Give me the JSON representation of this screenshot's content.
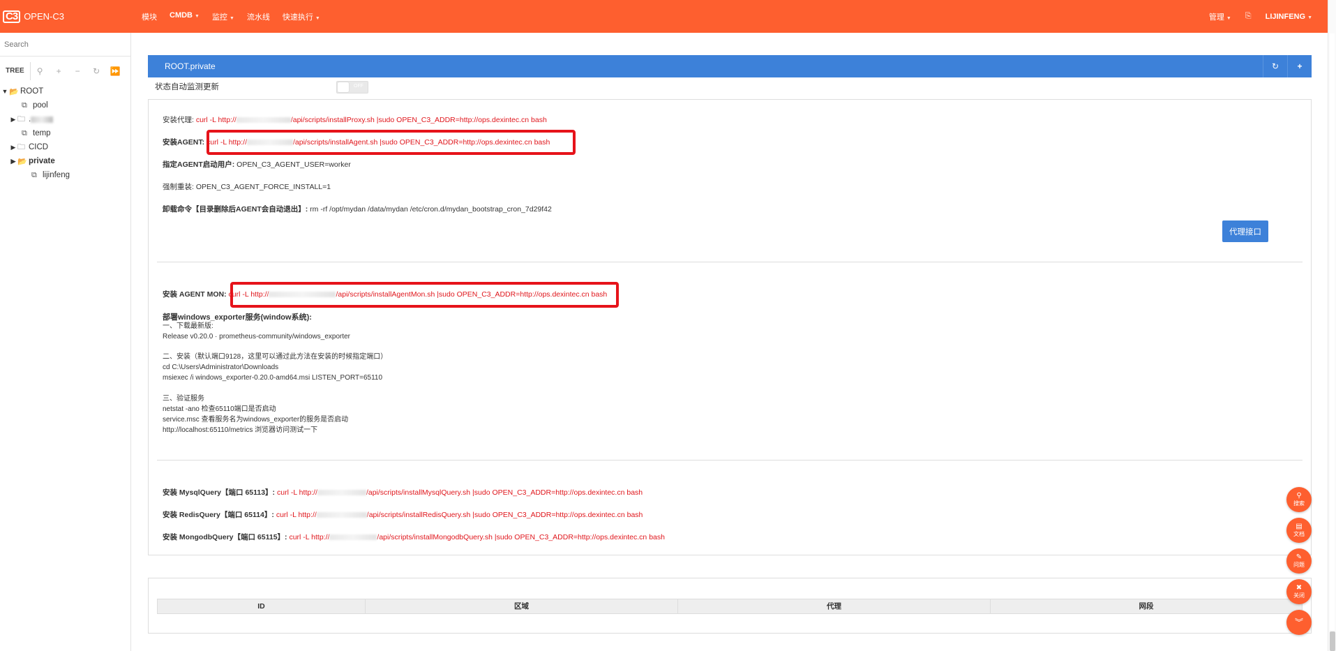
{
  "app": {
    "logo_mark": "C3",
    "logo_text": "OPEN-C3"
  },
  "nav": {
    "items": [
      {
        "label": "模块",
        "dropdown": false
      },
      {
        "label": "CMDB",
        "dropdown": true
      },
      {
        "label": "监控",
        "dropdown": true
      },
      {
        "label": "流水线",
        "dropdown": false
      },
      {
        "label": "快速执行",
        "dropdown": true
      }
    ],
    "manage_label": "管理",
    "user_label": "LIJINFENG"
  },
  "sidebar": {
    "search_placeholder": "Search",
    "tree_label": "TREE",
    "tools": [
      "pin-icon",
      "plus-icon",
      "minus-icon",
      "refresh-icon",
      "forward-icon"
    ],
    "nodes": [
      {
        "label": "ROOT",
        "level": 0,
        "arrow": "down",
        "icon": "folder-open",
        "bold": false
      },
      {
        "label": "pool",
        "level": 1,
        "arrow": "",
        "icon": "copy",
        "bold": false
      },
      {
        "label": ".",
        "level": 1,
        "arrow": "right",
        "icon": "folder",
        "bold": false,
        "blurred": true
      },
      {
        "label": "temp",
        "level": 1,
        "arrow": "",
        "icon": "copy",
        "bold": false
      },
      {
        "label": "CICD",
        "level": 1,
        "arrow": "right",
        "icon": "folder",
        "bold": false
      },
      {
        "label": "private",
        "level": 1,
        "arrow": "right",
        "icon": "folder-open",
        "bold": true
      },
      {
        "label": "lijinfeng",
        "level": 2,
        "arrow": "",
        "icon": "copy",
        "bold": false
      }
    ]
  },
  "panel": {
    "title": "ROOT.private",
    "status_label": "状态自动监测更新",
    "toggle_label": "OFF",
    "proxy_button": "代理接口"
  },
  "section1": {
    "proxy": {
      "label": "安装代理:",
      "cmd_pre": "curl -L http://",
      "cmd_post": "/api/scripts/installProxy.sh |sudo OPEN_C3_ADDR=http://ops.dexintec.cn bash"
    },
    "agent": {
      "label": "安装AGENT:",
      "cmd_pre": "curl -L http://",
      "cmd_post": "/api/scripts/installAgent.sh |sudo OPEN_C3_ADDR=http://ops.dexintec.cn bash"
    },
    "agent_user": {
      "label": "指定AGENT启动用户:",
      "value": "OPEN_C3_AGENT_USER=worker"
    },
    "force": {
      "label": "强制重装:",
      "value": "OPEN_C3_AGENT_FORCE_INSTALL=1"
    },
    "uninstall": {
      "label": "卸载命令【目录删除后AGENT会自动退出】:",
      "value": "rm -rf /opt/mydan /data/mydan /etc/cron.d/mydan_bootstrap_cron_7d29f42"
    }
  },
  "section2": {
    "agent_mon": {
      "label": "安装 AGENT MON:",
      "cmd_pre": "curl -L http://",
      "cmd_post": "/api/scripts/installAgentMon.sh |sudo OPEN_C3_ADDR=http://ops.dexintec.cn bash"
    },
    "win_title": "部署windows_exporter服务(window系统):",
    "win_step1": "一、下载最新版:\nRelease v0.20.0 · prometheus-community/windows_exporter",
    "win_step2": "二、安装（默认端口9128，这里可以通过此方法在安装的时候指定端口）\ncd C:\\Users\\Administrator\\Downloads\nmsiexec /i windows_exporter-0.20.0-amd64.msi LISTEN_PORT=65110",
    "win_step3": "三、验证服务\nnetstat -ano 检查65110端口是否启动\nservice.msc 查看服务名为windows_exporter的服务是否启动\nhttp://localhost:65110/metrics 浏览器访问测试一下"
  },
  "section3": {
    "mysql": {
      "label": "安装 MysqlQuery【端口 65113】:",
      "cmd_pre": "curl -L http://",
      "cmd_post": "/api/scripts/installMysqlQuery.sh |sudo OPEN_C3_ADDR=http://ops.dexintec.cn bash"
    },
    "redis": {
      "label": "安装 RedisQuery【端口 65114】:",
      "cmd_pre": "curl -L http://",
      "cmd_post": "/api/scripts/installRedisQuery.sh |sudo OPEN_C3_ADDR=http://ops.dexintec.cn bash"
    },
    "mongo": {
      "label": "安装 MongodbQuery【端口 65115】:",
      "cmd_pre": "curl -L http://",
      "cmd_post": "/api/scripts/installMongodbQuery.sh |sudo OPEN_C3_ADDR=http://ops.dexintec.cn bash"
    }
  },
  "table": {
    "columns": [
      "ID",
      "区域",
      "代理",
      "网段"
    ]
  },
  "fabs": [
    {
      "name": "search",
      "icon": "search-icon",
      "label": "搜索"
    },
    {
      "name": "docs",
      "icon": "book-icon",
      "label": "文档"
    },
    {
      "name": "issue",
      "icon": "edit-icon",
      "label": "问题"
    },
    {
      "name": "close",
      "icon": "close-icon",
      "label": "关闭"
    },
    {
      "name": "collapse",
      "icon": "double-chevron-down-icon",
      "label": ""
    }
  ],
  "colors": {
    "brand": "#fe5f2f",
    "panel": "#3d81d9",
    "command": "#e0161c",
    "highlight": "#e6131a"
  }
}
